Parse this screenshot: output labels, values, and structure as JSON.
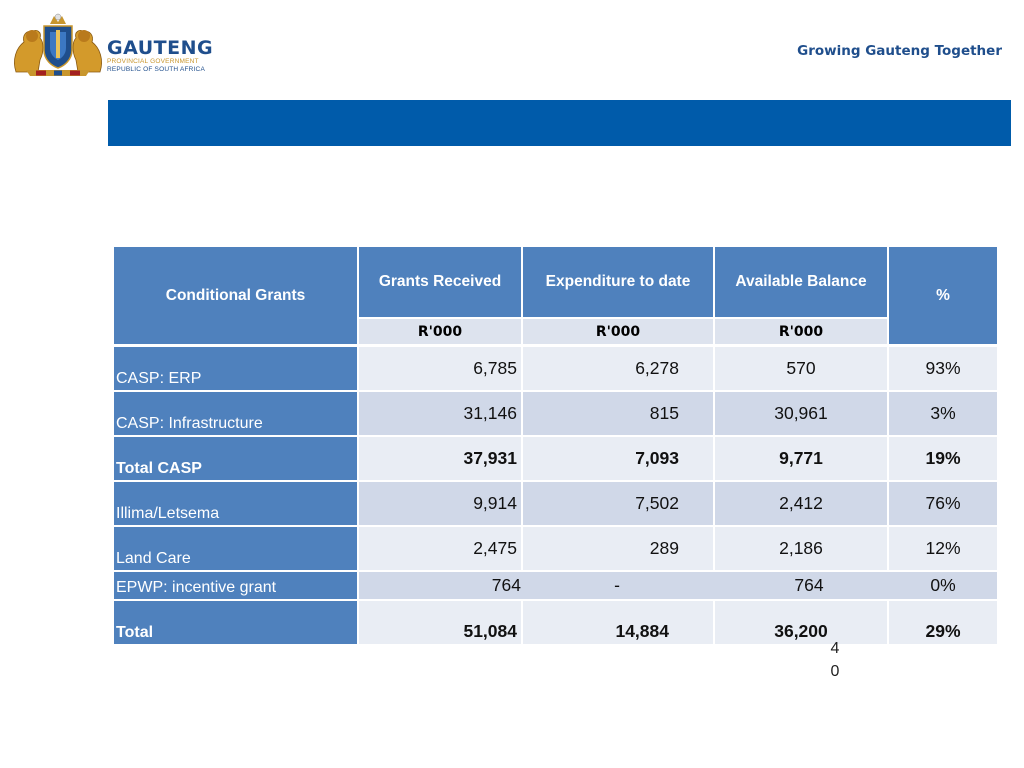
{
  "header": {
    "logo_name": "GAUTENG",
    "logo_sub1": "PROVINCIAL GOVERNMENT",
    "logo_sub2": "REPUBLIC OF SOUTH AFRICA",
    "tagline": "Growing Gauteng Together"
  },
  "table": {
    "col_label": "Conditional Grants",
    "col_received": "Grants Received",
    "col_expenditure": "Expenditure to date",
    "col_balance": "Available Balance",
    "col_percent": "%",
    "unit_received": "R'000",
    "unit_expenditure": "R'000",
    "unit_balance": "R'000",
    "rows": [
      {
        "label": "CASP: ERP",
        "received": "6,785",
        "expenditure": "6,278",
        "balance": "570",
        "percent": "93%"
      },
      {
        "label": "CASP: Infrastructure",
        "received": "31,146",
        "expenditure": "815",
        "balance": "30,961",
        "percent": "3%"
      },
      {
        "label": "Total CASP",
        "received": "37,931",
        "expenditure": "7,093",
        "balance": "9,771",
        "percent": "19%"
      },
      {
        "label": "Illima/Letsema",
        "received": "9,914",
        "expenditure": "7,502",
        "balance": "2,412",
        "percent": "76%"
      },
      {
        "label": "Land Care",
        "received": "2,475",
        "expenditure": "289",
        "balance": "2,186",
        "percent": "12%"
      },
      {
        "label": "EPWP: incentive grant",
        "received": "764",
        "expenditure": "-",
        "balance": "764",
        "percent": "0%"
      },
      {
        "label": "Total",
        "received": "51,084",
        "expenditure": "14,884",
        "balance": "36,200",
        "percent": "29%"
      }
    ]
  },
  "page_number": {
    "line1": "4",
    "line2": "0"
  },
  "colors": {
    "brand_blue": "#005baa",
    "header_blue": "#4f81bd",
    "row_light": "#e9edf4",
    "row_dark": "#d0d8e8"
  }
}
